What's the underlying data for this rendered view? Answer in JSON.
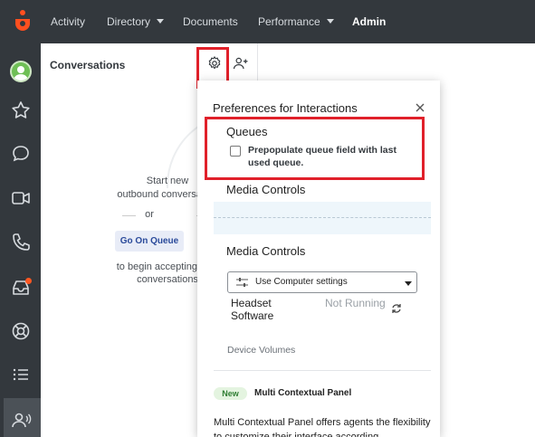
{
  "topnav": {
    "items": [
      {
        "label": "Activity",
        "dropdown": false
      },
      {
        "label": "Directory",
        "dropdown": true
      },
      {
        "label": "Documents",
        "dropdown": false
      },
      {
        "label": "Performance",
        "dropdown": true
      },
      {
        "label": "Admin",
        "dropdown": false,
        "active": true
      }
    ]
  },
  "sidebar": {
    "icons": [
      "avatar",
      "star-icon",
      "chat-icon",
      "video-icon",
      "phone-icon",
      "inbox-icon",
      "lifebuoy-icon",
      "list-icon",
      "agent-audio-icon"
    ],
    "notification_color": "#ff5722"
  },
  "conversations": {
    "title": "Conversations",
    "empty_line1": "Start new",
    "empty_line2": "outbound conversation",
    "or": "or",
    "go_on_queue": "Go On Queue",
    "empty_line3": "to begin accepting new",
    "empty_line4": "conversations"
  },
  "preferences": {
    "title": "Preferences for Interactions",
    "queues_title": "Queues",
    "prepopulate_label": "Prepopulate queue field with last used queue.",
    "prepopulate_checked": false,
    "media_controls_1": "Media Controls",
    "media_controls_2": "Media Controls",
    "audio_setting": "Use Computer settings",
    "headset_label": "Headset Software",
    "headset_status": "Not Running",
    "device_volumes": "Device Volumes",
    "new_badge": "New",
    "mcp_title": "Multi Contextual Panel",
    "mcp_desc": "Multi Contextual Panel offers agents the flexibility to customize their interface according"
  },
  "colors": {
    "topbar": "#33383d",
    "highlight": "#e0202a",
    "brand": "#ff4f1f"
  }
}
